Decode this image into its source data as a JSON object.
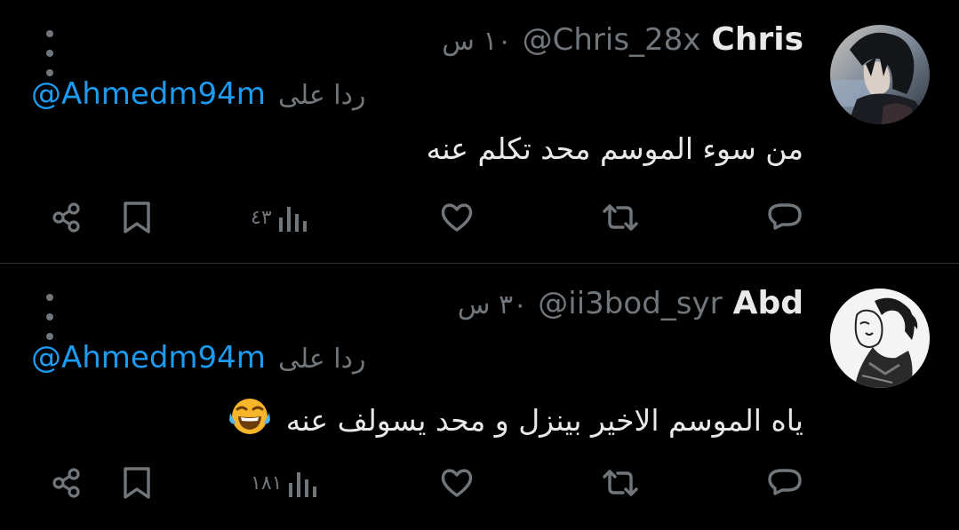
{
  "tweets": [
    {
      "display_name": "Chris",
      "handle": "@Chris_28x",
      "time": "١٠ س",
      "reply_prefix": "ردا على",
      "reply_mention": "@Ahmedm94m",
      "body": "من سوء الموسم محد تكلم عنه",
      "emoji": "",
      "views": "٤٣",
      "avatar": "anime-character-avatar"
    },
    {
      "display_name": "Abd",
      "handle": "@ii3bod_syr",
      "time": "٣٠ س",
      "reply_prefix": "ردا على",
      "reply_mention": "@Ahmedm94m",
      "body": "ياه الموسم الاخير بينزل و محد يسولف عنه",
      "emoji": "face-with-tears-of-joy",
      "views": "١٨١",
      "avatar": "manga-sketch-avatar"
    }
  ],
  "icons": {
    "share": "share-icon",
    "bookmark": "bookmark-icon",
    "views": "views-chart-icon",
    "like": "heart-icon",
    "retweet": "retweet-icon",
    "reply": "reply-icon",
    "more": "more-vertical-icon"
  },
  "colors": {
    "background": "#000000",
    "text": "#e7e9ea",
    "muted": "#71767b",
    "link": "#1d9bf0",
    "divider": "#2f3336"
  }
}
